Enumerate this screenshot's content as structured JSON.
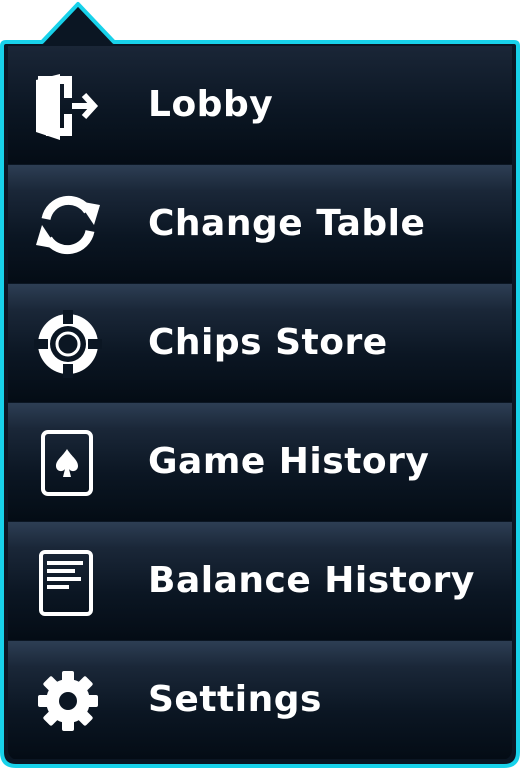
{
  "colors": {
    "border": "#18d2ea",
    "background": "#0b1623",
    "text": "#ffffff"
  },
  "menu": {
    "items": [
      {
        "label": "Lobby",
        "icon": "exit-door-icon"
      },
      {
        "label": "Change Table",
        "icon": "refresh-arrows-icon"
      },
      {
        "label": "Chips Store",
        "icon": "poker-chip-icon"
      },
      {
        "label": "Game History",
        "icon": "spade-card-icon"
      },
      {
        "label": "Balance History",
        "icon": "document-icon"
      },
      {
        "label": "Settings",
        "icon": "gear-icon"
      }
    ]
  }
}
